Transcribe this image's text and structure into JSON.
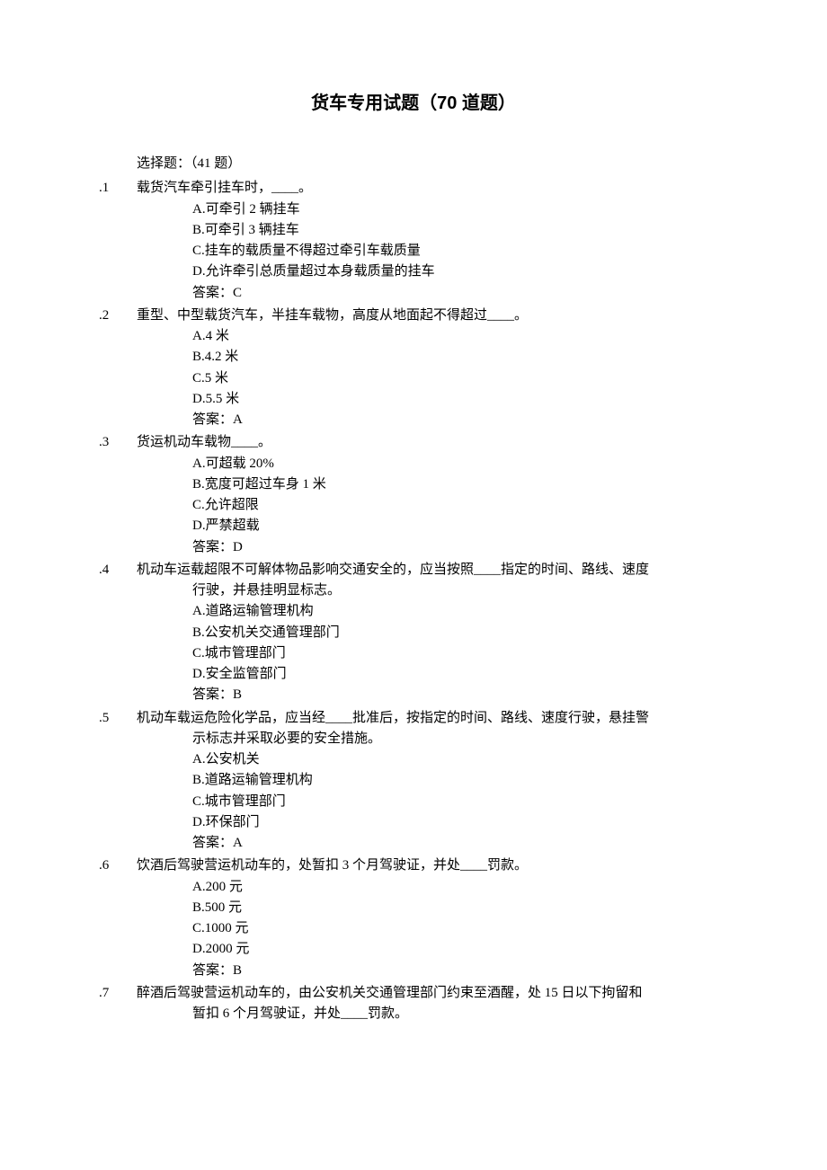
{
  "title": "货车专用试题（70 道题）",
  "section": "选择题：（41 题）",
  "questions": [
    {
      "num": ".1",
      "stem": "载货汽车牵引挂车时，____。",
      "opts": [
        "A.可牵引 2 辆挂车",
        "B.可牵引 3 辆挂车",
        "C.挂车的载质量不得超过牵引车载质量",
        "D.允许牵引总质量超过本身载质量的挂车"
      ],
      "ans": "答案：C"
    },
    {
      "num": ".2",
      "stem": "重型、中型载货汽车，半挂车载物，高度从地面起不得超过____。",
      "opts": [
        "A.4 米",
        "B.4.2 米",
        "C.5 米",
        "D.5.5 米"
      ],
      "ans": "答案：A"
    },
    {
      "num": ".3",
      "stem": "货运机动车载物____。",
      "opts": [
        "A.可超载 20%",
        "B.宽度可超过车身 1 米",
        "C.允许超限",
        "D.严禁超载"
      ],
      "ans": "答案：D"
    },
    {
      "num": ".4",
      "stem": "机动车运载超限不可解体物品影响交通安全的，应当按照____指定的时间、路线、速度",
      "cont": "行驶，并悬挂明显标志。",
      "opts": [
        "A.道路运输管理机构",
        "B.公安机关交通管理部门",
        "C.城市管理部门",
        "D.安全监管部门"
      ],
      "ans": "答案：B"
    },
    {
      "num": ".5",
      "stem": "机动车载运危险化学品，应当经____批准后，按指定的时间、路线、速度行驶，悬挂警",
      "cont": "示标志并采取必要的安全措施。",
      "opts": [
        "A.公安机关",
        "B.道路运输管理机构",
        "C.城市管理部门",
        "D.环保部门"
      ],
      "ans": "答案：A"
    },
    {
      "num": ".6",
      "stem": "饮酒后驾驶营运机动车的，处暂扣 3 个月驾驶证，并处____罚款。",
      "opts": [
        "A.200 元",
        "B.500 元",
        "C.1000 元",
        "D.2000 元"
      ],
      "ans": "答案：B"
    },
    {
      "num": ".7",
      "stem": "醉酒后驾驶营运机动车的，由公安机关交通管理部门约束至酒醒，处 15 日以下拘留和",
      "cont": "暂扣 6 个月驾驶证，并处____罚款。"
    }
  ]
}
